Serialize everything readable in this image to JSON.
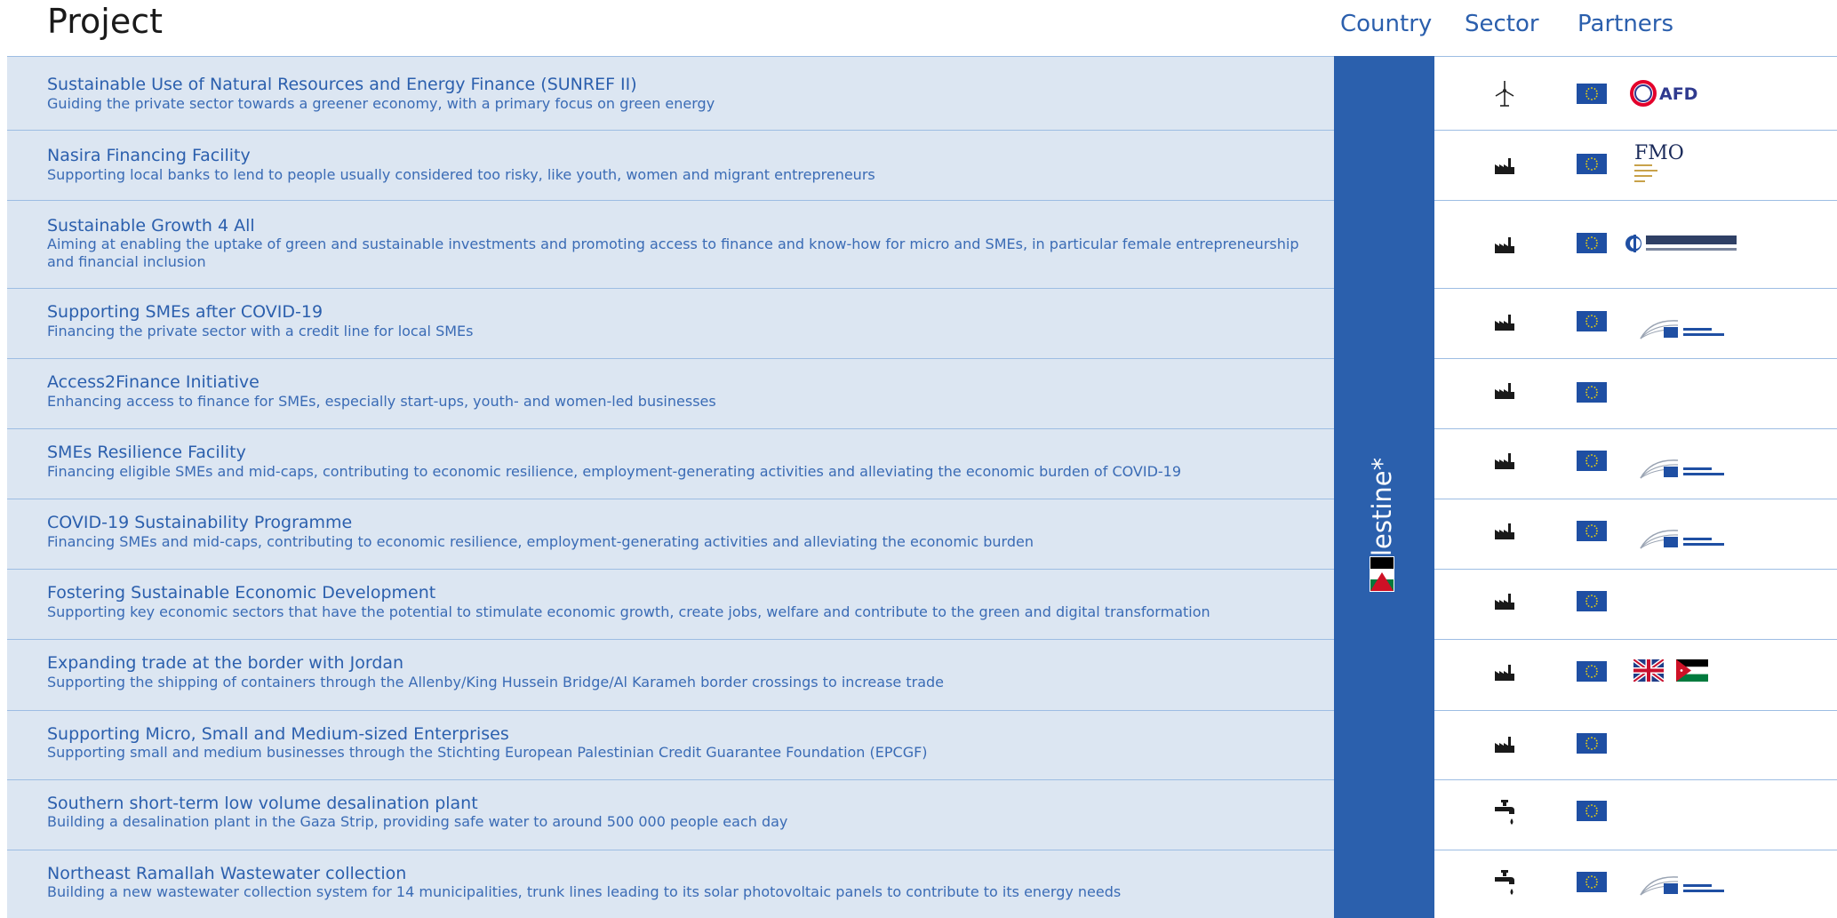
{
  "header": {
    "project": "Project",
    "country": "Country",
    "sector": "Sector",
    "partners": "Partners"
  },
  "country": {
    "name": "Palestine*",
    "flag_colors": [
      "#000000",
      "#ffffff",
      "#007a3d",
      "#ce1126"
    ]
  },
  "colors": {
    "row_background": "#dce6f2",
    "title_blue": "#2b5fad",
    "country_band": "#2b60ad",
    "eu_flag_blue": "#1f4fa3",
    "eu_star_yellow": "#ffdd00"
  },
  "rows": [
    {
      "title": "Sustainable Use of Natural Resources and Energy Finance (SUNREF II)",
      "desc": "Guiding the private sector towards a greener economy, with a primary focus on green energy",
      "sector_icon": "wind-turbine-icon",
      "partners": [
        "eu-flag",
        "afd-logo"
      ]
    },
    {
      "title": "Nasira Financing Facility",
      "desc": "Supporting local banks to lend to people usually considered too risky, like youth, women and migrant entrepreneurs",
      "sector_icon": "factory-icon",
      "partners": [
        "eu-flag",
        "fmo-logo"
      ]
    },
    {
      "title": "Sustainable Growth 4 All",
      "desc": "Aiming at enabling the uptake of green and sustainable investments and promoting access to finance and know-how for micro and SMEs, in particular female entrepreneurship and financial inclusion",
      "sector_icon": "factory-icon",
      "partners": [
        "eu-flag",
        "ebrd-logo"
      ]
    },
    {
      "title": "Supporting SMEs after COVID-19",
      "desc": "Financing the private sector with a credit line for local SMEs",
      "sector_icon": "factory-icon",
      "partners": [
        "eu-flag",
        "eib-logo"
      ]
    },
    {
      "title": "Access2Finance Initiative",
      "desc": "Enhancing access to finance for SMEs, especially start-ups, youth- and women-led businesses",
      "sector_icon": "factory-icon",
      "partners": [
        "eu-flag"
      ]
    },
    {
      "title": "SMEs Resilience Facility",
      "desc": "Financing eligible SMEs and mid-caps, contributing to economic resilience, employment-generating activities and alleviating the economic burden of COVID-19",
      "sector_icon": "factory-icon",
      "partners": [
        "eu-flag",
        "eib-logo"
      ]
    },
    {
      "title": "COVID-19 Sustainability Programme",
      "desc": "Financing SMEs and mid-caps, contributing to economic resilience, employment-generating activities and alleviating the economic burden",
      "sector_icon": "factory-icon",
      "partners": [
        "eu-flag",
        "eib-logo"
      ]
    },
    {
      "title": "Fostering Sustainable Economic Development",
      "desc": "Supporting key economic sectors that have the potential to stimulate economic growth, create jobs, welfare and contribute to the green and digital transformation",
      "sector_icon": "factory-icon",
      "partners": [
        "eu-flag"
      ]
    },
    {
      "title": "Expanding trade at the border with Jordan",
      "desc": "Supporting the shipping of containers through the Allenby/King Hussein Bridge/Al Karameh border crossings to increase trade",
      "sector_icon": "factory-icon",
      "partners": [
        "eu-flag",
        "uk-flag",
        "jordan-flag"
      ]
    },
    {
      "title": "Supporting Micro, Small and Medium-sized Enterprises",
      "desc": "Supporting small and medium businesses through the Stichting  European Palestinian Credit Guarantee Foundation (EPCGF)",
      "sector_icon": "factory-icon",
      "partners": [
        "eu-flag"
      ]
    },
    {
      "title": "Southern short-term low volume desalination plant",
      "desc": "Building a desalination plant in the Gaza Strip, providing safe water to around 500 000 people each day",
      "sector_icon": "water-tap-icon",
      "partners": [
        "eu-flag"
      ]
    },
    {
      "title": "Northeast Ramallah Wastewater collection",
      "desc": "Building a new wastewater collection system for 14 municipalities, trunk lines leading to its solar photovoltaic panels to contribute to its energy needs",
      "sector_icon": "water-tap-icon",
      "partners": [
        "eu-flag",
        "eib-logo"
      ]
    }
  ]
}
